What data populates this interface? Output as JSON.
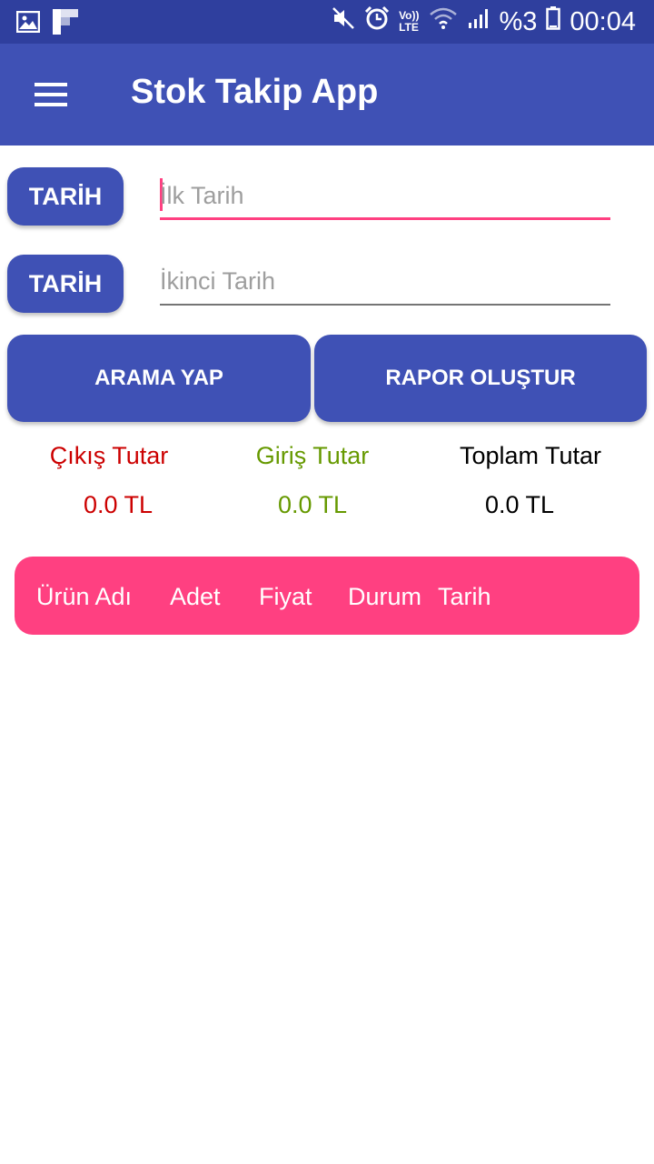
{
  "status_bar": {
    "icons_left": [
      "image-icon",
      "flipboard-icon"
    ],
    "icons_right": [
      "mute-icon",
      "alarm-icon",
      "volte-icon",
      "wifi-icon",
      "signal-icon"
    ],
    "volte_label_top": "Vo))",
    "volte_label_bottom": "LTE",
    "battery_percent": "%3",
    "time": "00:04",
    "bg_color": "#2F3F9E"
  },
  "app_bar": {
    "title": "Stok Takip App",
    "bg_color": "#3F51B5"
  },
  "date_filters": [
    {
      "button_label": "TARİH",
      "placeholder": "İlk Tarih",
      "focused": true
    },
    {
      "button_label": "TARİH",
      "placeholder": "İkinci Tarih",
      "focused": false
    }
  ],
  "actions": {
    "search_label": "ARAMA YAP",
    "report_label": "RAPOR OLUŞTUR"
  },
  "totals": {
    "out": {
      "label": "Çıkış Tutar",
      "value": "0.0 TL",
      "color": "#CC0000"
    },
    "in": {
      "label": "Giriş Tutar",
      "value": "0.0 TL",
      "color": "#669900"
    },
    "total": {
      "label": "Toplam Tutar",
      "value": "0.0 TL",
      "color": "#000000"
    }
  },
  "table_header": {
    "columns": [
      "Ürün Adı",
      "Adet",
      "Fiyat",
      "Durum",
      "Tarih"
    ],
    "bg_color": "#FF4081"
  },
  "colors": {
    "primary": "#3F51B5",
    "accent": "#FF4081"
  }
}
